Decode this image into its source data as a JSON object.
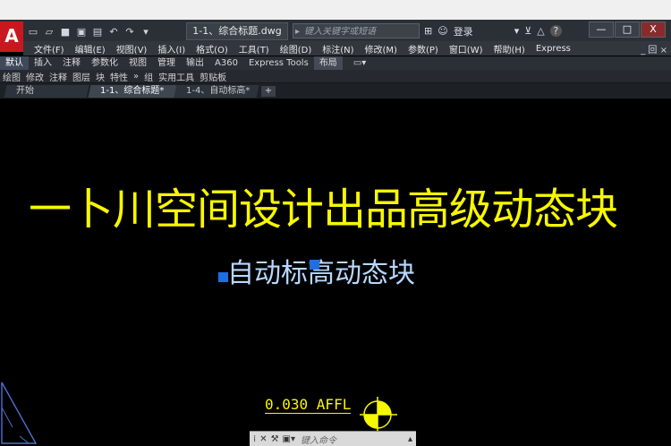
{
  "window": {
    "title": "1-1、综合标题.dwg",
    "search_placeholder": "键入关键字或短语",
    "login": "登录",
    "help": "?"
  },
  "window_controls": [
    "—",
    "□",
    "X"
  ],
  "menubar": [
    "文件(F)",
    "编辑(E)",
    "视图(V)",
    "插入(I)",
    "格式(O)",
    "工具(T)",
    "绘图(D)",
    "标注(N)",
    "修改(M)",
    "参数(P)",
    "窗口(W)",
    "帮助(H)",
    "Express"
  ],
  "menubar_right": "_ 回 ×",
  "ribbon_tabs": [
    "默认",
    "插入",
    "注释",
    "参数化",
    "视图",
    "管理",
    "输出",
    "A360",
    "Express Tools",
    "布局"
  ],
  "ribbon_panels": [
    "绘图",
    "修改",
    "注释",
    "图层",
    "块",
    "特性",
    "»",
    "组",
    "实用工具",
    "剪贴板"
  ],
  "doc_tabs": {
    "start": "开始",
    "tab1": "1-1、综合标题*",
    "tab2": "1-4、自动标高*",
    "plus": "+"
  },
  "canvas": {
    "heading": "一卜川空间设计出品高级动态块",
    "subheading": "自动标高动态块",
    "affl": "0.030 AFFL"
  },
  "command": {
    "placeholder": "键入命令"
  },
  "colors": {
    "accent_yellow": "#f7f700",
    "grip_blue": "#1e6fe0",
    "text_blue": "#b8d8ff"
  }
}
